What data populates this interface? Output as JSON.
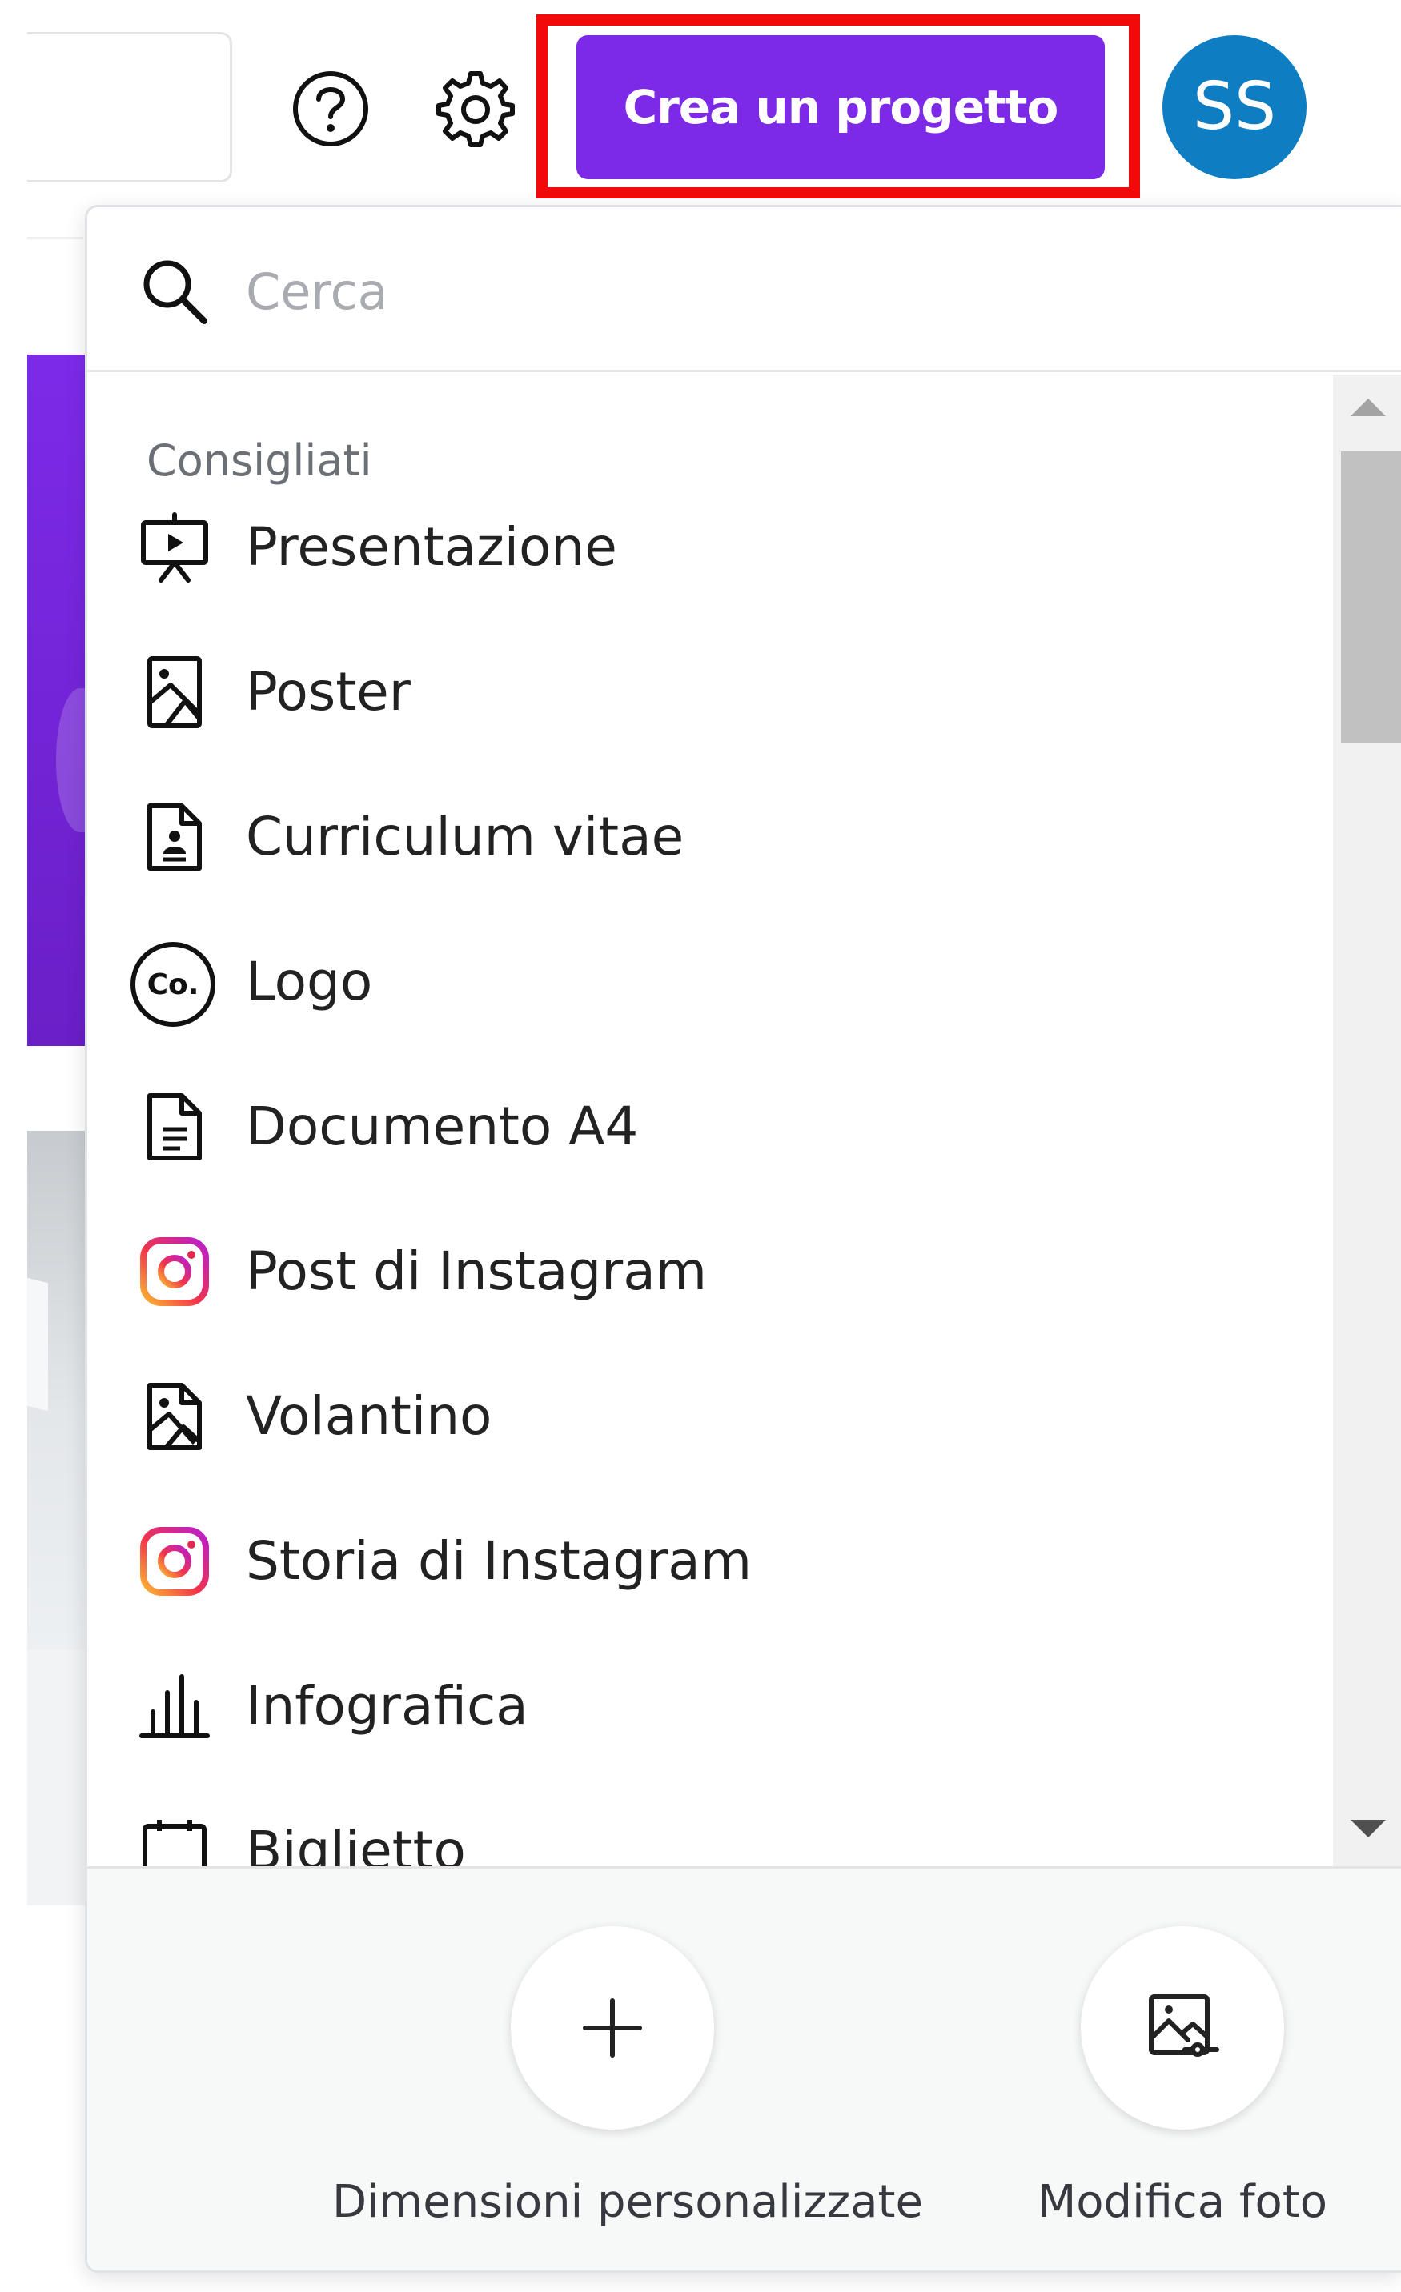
{
  "header": {
    "create_button_label": "Crea un progetto",
    "avatar_initials": "SS",
    "help_icon": "question-circle-icon",
    "settings_icon": "gear-icon"
  },
  "dropdown": {
    "search_placeholder": "Cerca",
    "section_heading": "Consigliati",
    "items": [
      {
        "label": "Presentazione",
        "icon": "presentation-icon"
      },
      {
        "label": "Poster",
        "icon": "poster-icon"
      },
      {
        "label": "Curriculum vitae",
        "icon": "resume-icon"
      },
      {
        "label": "Logo",
        "icon": "logo-co-icon"
      },
      {
        "label": "Documento A4",
        "icon": "document-icon"
      },
      {
        "label": "Post di Instagram",
        "icon": "instagram-icon"
      },
      {
        "label": "Volantino",
        "icon": "flyer-icon"
      },
      {
        "label": "Storia di Instagram",
        "icon": "instagram-icon"
      },
      {
        "label": "Infografica",
        "icon": "bar-chart-icon"
      },
      {
        "label": "Biglietto",
        "icon": "card-icon"
      }
    ],
    "footer": {
      "custom_size_label": "Dimensioni personalizzate",
      "edit_photo_label": "Modifica foto"
    }
  },
  "colors": {
    "primary_purple": "#7d2ae8",
    "avatar_blue": "#0f7dc2",
    "highlight_red": "#f20a0a"
  }
}
